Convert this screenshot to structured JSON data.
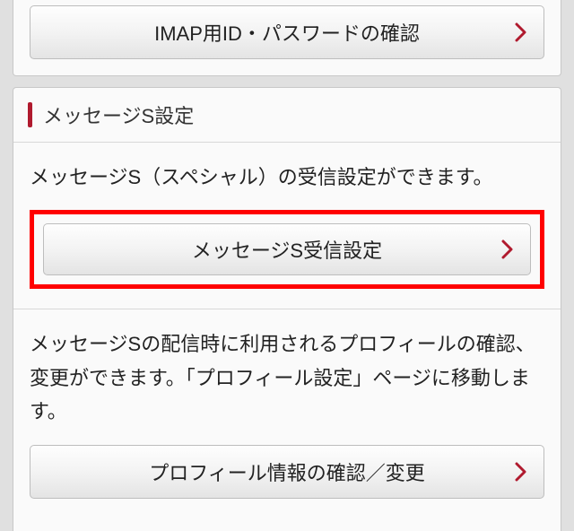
{
  "top_card": {
    "imap_button": "IMAP用ID・パスワードの確認"
  },
  "message_s": {
    "header_title": "メッセージS設定",
    "desc1": "メッセージS（スペシャル）の受信設定ができます。",
    "button_receive": "メッセージS受信設定",
    "desc2": "メッセージSの配信時に利用されるプロフィールの確認、変更ができます。「プロフィール設定」ページに移動します。",
    "button_profile": "プロフィール情報の確認／変更"
  },
  "colors": {
    "accent": "#b01a2e",
    "highlight": "#ff0000"
  }
}
